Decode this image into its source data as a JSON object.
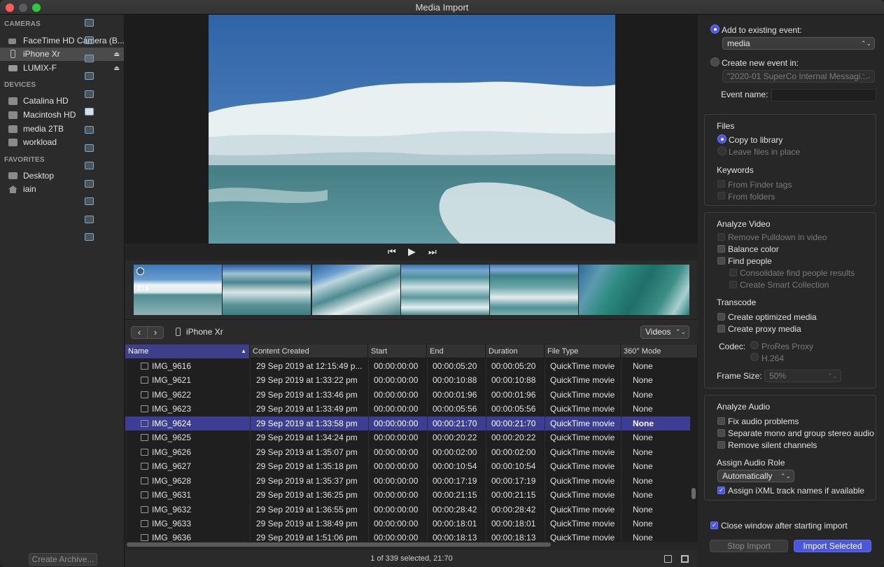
{
  "window": {
    "title": "Media Import"
  },
  "sidebar": {
    "cameras_header": "CAMERAS",
    "cameras": [
      {
        "label": "FaceTime HD Camera (B...",
        "icon": "video-camera-icon"
      },
      {
        "label": "iPhone Xr",
        "icon": "iphone-icon",
        "selected": true
      },
      {
        "label": "LUMIX-F",
        "icon": "camera-icon"
      }
    ],
    "devices_header": "DEVICES",
    "devices": [
      {
        "label": "Catalina HD",
        "icon": "hard-drive-icon"
      },
      {
        "label": "Macintosh HD",
        "icon": "hard-drive-icon"
      },
      {
        "label": "media 2TB",
        "icon": "hard-drive-icon"
      },
      {
        "label": "workload",
        "icon": "hard-drive-icon"
      }
    ],
    "favorites_header": "FAVORITES",
    "favorites": [
      {
        "label": "Desktop",
        "icon": "desktop-icon"
      },
      {
        "label": "iain",
        "icon": "home-icon"
      }
    ],
    "create_archive": "Create Archive..."
  },
  "viewer": {
    "thumb_duration": "21s"
  },
  "browser": {
    "device": "iPhone Xr",
    "filter": "Videos",
    "columns": [
      "Name",
      "Content Created",
      "Start",
      "End",
      "Duration",
      "File Type",
      "360° Mode"
    ],
    "rows": [
      {
        "name": "IMG_9616",
        "created": "29 Sep 2019 at 12:15:49 p...",
        "start": "00:00:00:00",
        "end": "00:00:05:20",
        "duration": "00:00:05:20",
        "type": "QuickTime movie",
        "mode": "None"
      },
      {
        "name": "IMG_9621",
        "created": "29 Sep 2019 at 1:33:22 pm",
        "start": "00:00:00:00",
        "end": "00:00:10:88",
        "duration": "00:00:10:88",
        "type": "QuickTime movie",
        "mode": "None"
      },
      {
        "name": "IMG_9622",
        "created": "29 Sep 2019 at 1:33:46 pm",
        "start": "00:00:00:00",
        "end": "00:00:01:96",
        "duration": "00:00:01:96",
        "type": "QuickTime movie",
        "mode": "None"
      },
      {
        "name": "IMG_9623",
        "created": "29 Sep 2019 at 1:33:49 pm",
        "start": "00:00:00:00",
        "end": "00:00:05:56",
        "duration": "00:00:05:56",
        "type": "QuickTime movie",
        "mode": "None"
      },
      {
        "name": "IMG_9624",
        "created": "29 Sep 2019 at 1:33:58 pm",
        "start": "00:00:00:00",
        "end": "00:00:21:70",
        "duration": "00:00:21:70",
        "type": "QuickTime movie",
        "mode": "None",
        "selected": true
      },
      {
        "name": "IMG_9625",
        "created": "29 Sep 2019 at 1:34:24 pm",
        "start": "00:00:00:00",
        "end": "00:00:20:22",
        "duration": "00:00:20:22",
        "type": "QuickTime movie",
        "mode": "None"
      },
      {
        "name": "IMG_9626",
        "created": "29 Sep 2019 at 1:35:07 pm",
        "start": "00:00:00:00",
        "end": "00:00:02:00",
        "duration": "00:00:02:00",
        "type": "QuickTime movie",
        "mode": "None"
      },
      {
        "name": "IMG_9627",
        "created": "29 Sep 2019 at 1:35:18 pm",
        "start": "00:00:00:00",
        "end": "00:00:10:54",
        "duration": "00:00:10:54",
        "type": "QuickTime movie",
        "mode": "None"
      },
      {
        "name": "IMG_9628",
        "created": "29 Sep 2019 at 1:35:37 pm",
        "start": "00:00:00:00",
        "end": "00:00:17:19",
        "duration": "00:00:17:19",
        "type": "QuickTime movie",
        "mode": "None"
      },
      {
        "name": "IMG_9631",
        "created": "29 Sep 2019 at 1:36:25 pm",
        "start": "00:00:00:00",
        "end": "00:00:21:15",
        "duration": "00:00:21:15",
        "type": "QuickTime movie",
        "mode": "None"
      },
      {
        "name": "IMG_9632",
        "created": "29 Sep 2019 at 1:36:55 pm",
        "start": "00:00:00:00",
        "end": "00:00:28:42",
        "duration": "00:00:28:42",
        "type": "QuickTime movie",
        "mode": "None"
      },
      {
        "name": "IMG_9633",
        "created": "29 Sep 2019 at 1:38:49 pm",
        "start": "00:00:00:00",
        "end": "00:00:18:01",
        "duration": "00:00:18:01",
        "type": "QuickTime movie",
        "mode": "None"
      },
      {
        "name": "IMG_9636",
        "created": "29 Sep 2019 at 1:51:06 pm",
        "start": "00:00:00:00",
        "end": "00:00:18:13",
        "duration": "00:00:18:13",
        "type": "QuickTime movie",
        "mode": "None"
      }
    ],
    "status": "1 of 339 selected, 21:70"
  },
  "options": {
    "add_existing": "Add to existing event:",
    "existing_event": "media",
    "create_new": "Create new event in:",
    "new_event_library": "\"2020-01 SuperCo Internal Messagi...",
    "event_name_label": "Event name:",
    "files_header": "Files",
    "copy_to_library": "Copy to library",
    "leave_in_place": "Leave files in place",
    "keywords_header": "Keywords",
    "from_finder_tags": "From Finder tags",
    "from_folders": "From folders",
    "analyze_video_header": "Analyze Video",
    "remove_pulldown": "Remove Pulldown in video",
    "balance_color": "Balance color",
    "find_people": "Find people",
    "consolidate": "Consolidate find people results",
    "smart_collection": "Create Smart Collection",
    "transcode_header": "Transcode",
    "optimized": "Create optimized media",
    "proxy": "Create proxy media",
    "codec_label": "Codec:",
    "codec_prores": "ProRes Proxy",
    "codec_h264": "H.264",
    "frame_size_label": "Frame Size:",
    "frame_size": "50%",
    "analyze_audio_header": "Analyze Audio",
    "fix_audio": "Fix audio problems",
    "separate_mono": "Separate mono and group stereo audio",
    "remove_silent": "Remove silent channels",
    "assign_role_label": "Assign Audio Role",
    "assign_role": "Automatically",
    "ixml": "Assign iXML track names if available",
    "close_window": "Close window after starting import",
    "stop_import": "Stop Import",
    "import_selected": "Import Selected"
  },
  "colors": {
    "accent": "#4a57d8",
    "selection": "#3c3e93"
  }
}
